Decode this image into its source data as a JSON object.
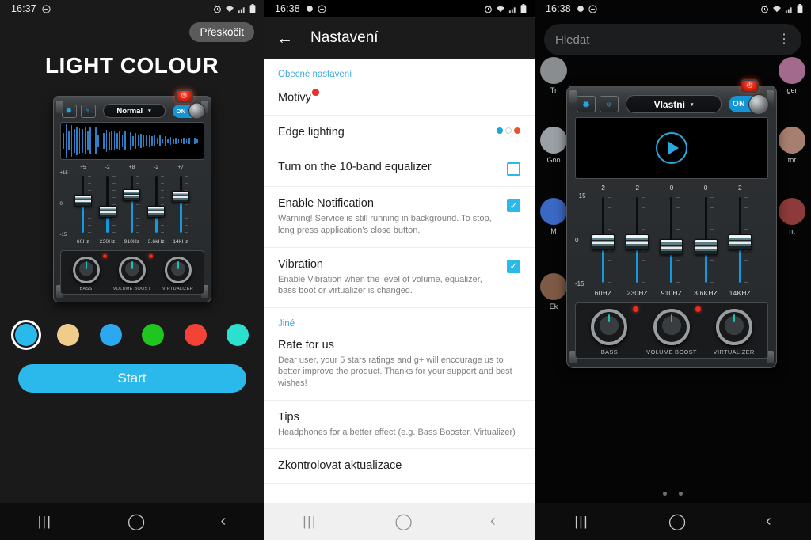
{
  "screens": {
    "onboarding": {
      "status": {
        "time": "16:37",
        "icons": [
          "dnd-icon",
          "alarm-icon",
          "wifi-icon",
          "signal-icon",
          "battery-icon"
        ]
      },
      "skip_label": "Přeskočit",
      "title": "LIGHT COLOUR",
      "equalizer": {
        "preset": "Normal",
        "toggle_label": "ON",
        "toggle_on": true,
        "axis": {
          "top": "+15",
          "mid": "0",
          "bottom": "-15"
        },
        "band_values": [
          "+5",
          "-2",
          "+8",
          "-2",
          "+7"
        ],
        "band_freqs": [
          "60Hz",
          "230Hz",
          "910Hz",
          "3.6kHz",
          "14kHz"
        ],
        "knobs": [
          "BASS",
          "VOLUME BOOST",
          "VIRTUALIZER"
        ]
      },
      "colors": [
        "#2bb9ec",
        "#f0cc8a",
        "#2ba8f0",
        "#1ec61e",
        "#f44336",
        "#2ce0cf"
      ],
      "selected_color_index": 0,
      "start_label": "Start"
    },
    "settings": {
      "status": {
        "time": "16:38"
      },
      "title": "Nastavení",
      "back_icon": "back-arrow-icon",
      "section_general": "Obecné nastavení",
      "section_other": "Jiné",
      "items": [
        {
          "title": "Motivy",
          "sub": "",
          "accessory": "badge"
        },
        {
          "title": "Edge lighting",
          "sub": "",
          "accessory": "color-dots",
          "dots": [
            "#1aa9d6",
            "#ffffff",
            "#ef5126"
          ]
        },
        {
          "title": "Turn on the 10-band equalizer",
          "sub": "",
          "accessory": "checkbox",
          "checked": false
        },
        {
          "title": "Enable Notification",
          "sub": "Warning! Service is still running in background. To stop, long press application's close button.",
          "accessory": "checkbox",
          "checked": true
        },
        {
          "title": "Vibration",
          "sub": "Enable Vibration when the level of volume, equalizer, bass boot or virtualizer is changed.",
          "accessory": "checkbox",
          "checked": true
        },
        {
          "title": "Rate for us",
          "sub": "Dear user, your 5 stars ratings and g+ will encourage us to better improve the product. Thanks for your support and best wishes!",
          "accessory": "none"
        },
        {
          "title": "Tips",
          "sub": "Headphones for a better effect (e.g. Bass Booster, Virtualizer)",
          "accessory": "none"
        },
        {
          "title": "Zkontrolovat aktualizace",
          "sub": "",
          "accessory": "none"
        }
      ]
    },
    "home": {
      "status": {
        "time": "16:38"
      },
      "search_placeholder": "Hledat",
      "menu_icon": "kebab-menu-icon",
      "app_icons": [
        {
          "label": "Tr",
          "color": "#8a8d90"
        },
        {
          "label": "Goo",
          "color": "#9aa0a6"
        },
        {
          "label": "M",
          "color": "#3b68c4"
        },
        {
          "label": "Ek",
          "color": "#7d5a45"
        },
        {
          "label": "ger",
          "color": "#a26a8c"
        },
        {
          "label": "tor",
          "color": "#a77f70"
        },
        {
          "label": "nt",
          "color": "#8c3a3a"
        }
      ],
      "widget": {
        "preset": "Vlastní",
        "toggle_label": "ON",
        "play_icon": "play-icon",
        "axis": {
          "top": "+15",
          "mid": "0",
          "bottom": "-15"
        },
        "band_values": [
          "2",
          "2",
          "0",
          "0",
          "2"
        ],
        "band_freqs": [
          "60HZ",
          "230HZ",
          "910HZ",
          "3.6KHZ",
          "14KHZ"
        ],
        "knobs": [
          "BASS",
          "VOLUME BOOST",
          "VIRTUALIZER"
        ]
      },
      "page_dots": 2
    }
  },
  "navbar": {
    "recent": "|||",
    "home": "◯",
    "back": "‹"
  }
}
